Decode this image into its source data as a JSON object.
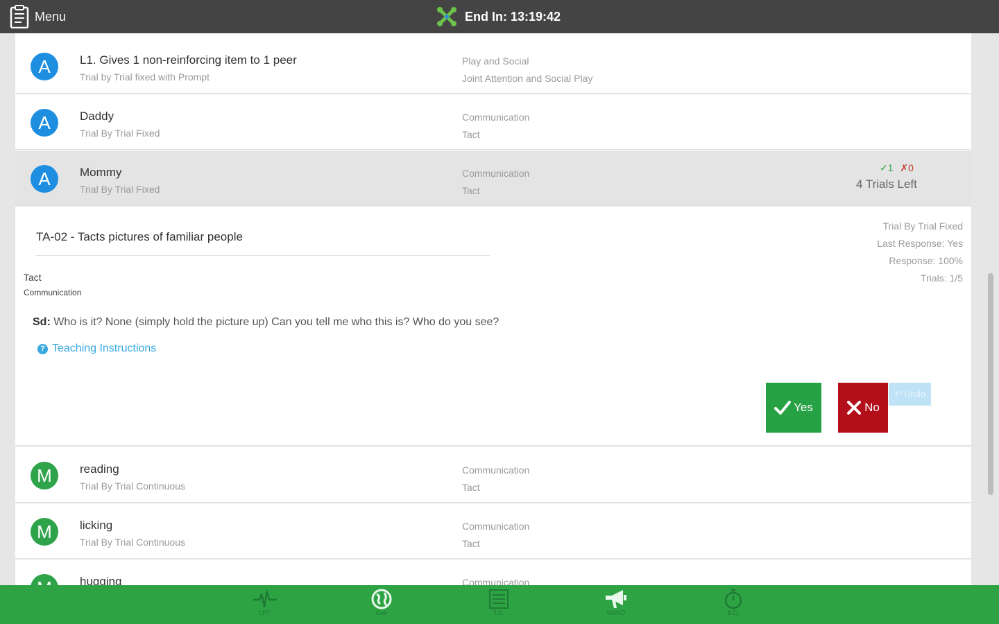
{
  "topbar": {
    "menu_label": "Menu",
    "timer_text": "End In: 13:19:42"
  },
  "rows_top": [
    {
      "badge": "A",
      "title": "L1. Gives 1 non-reinforcing item to 1 peer",
      "subtitle": "Trial by Trial fixed with Prompt",
      "category": "Play and Social",
      "subcategory": "Joint Attention and Social Play"
    },
    {
      "badge": "A",
      "title": "Daddy",
      "subtitle": "Trial By Trial Fixed",
      "category": "Communication",
      "subcategory": "Tact"
    },
    {
      "badge": "A",
      "title": "Mommy",
      "subtitle": "Trial By Trial Fixed",
      "category": "Communication",
      "subcategory": "Tact",
      "score_correct": "1",
      "score_incorrect": "0",
      "trials_left": "4 Trials Left"
    }
  ],
  "detail": {
    "title": "TA-02 - Tacts pictures of familiar people",
    "skill": "Tact",
    "domain": "Communication",
    "sd_label": "Sd:",
    "sd_text": "Who is it? None (simply hold the picture up) Can you tell me who this is? Who do you see?",
    "teaching_link": "Teaching Instructions",
    "meta": [
      "Trial By Trial Fixed",
      "Last Response: Yes",
      "Response: 100%",
      "Trials: 1/5"
    ],
    "yes_label": "Yes",
    "no_label": "No",
    "undo_label": "Undo"
  },
  "rows_bottom": [
    {
      "badge": "M",
      "title": "reading",
      "subtitle": "Trial By Trial Continuous",
      "category": "Communication",
      "subcategory": "Tact"
    },
    {
      "badge": "M",
      "title": "licking",
      "subtitle": "Trial By Trial Continuous",
      "category": "Communication",
      "subcategory": "Tact"
    },
    {
      "badge": "M",
      "title": "hugging",
      "subtitle": "",
      "category": "Communication",
      "subcategory": ""
    }
  ],
  "bottom_nav": [
    {
      "label": "LRT",
      "icon": "pulse-icon"
    },
    {
      "label": "Gen",
      "icon": "globe-icon"
    },
    {
      "label": "T.A.",
      "icon": "list-icon"
    },
    {
      "label": "MAND",
      "icon": "megaphone-icon"
    },
    {
      "label": "B.D.",
      "icon": "stopwatch-icon"
    }
  ],
  "colors": {
    "topbar": "#444444",
    "bottombar": "#2ea344",
    "badge_a": "#1e8fe0",
    "badge_m": "#2ea349",
    "yes": "#26a144",
    "no": "#b30f1b",
    "link": "#38a8e0"
  }
}
